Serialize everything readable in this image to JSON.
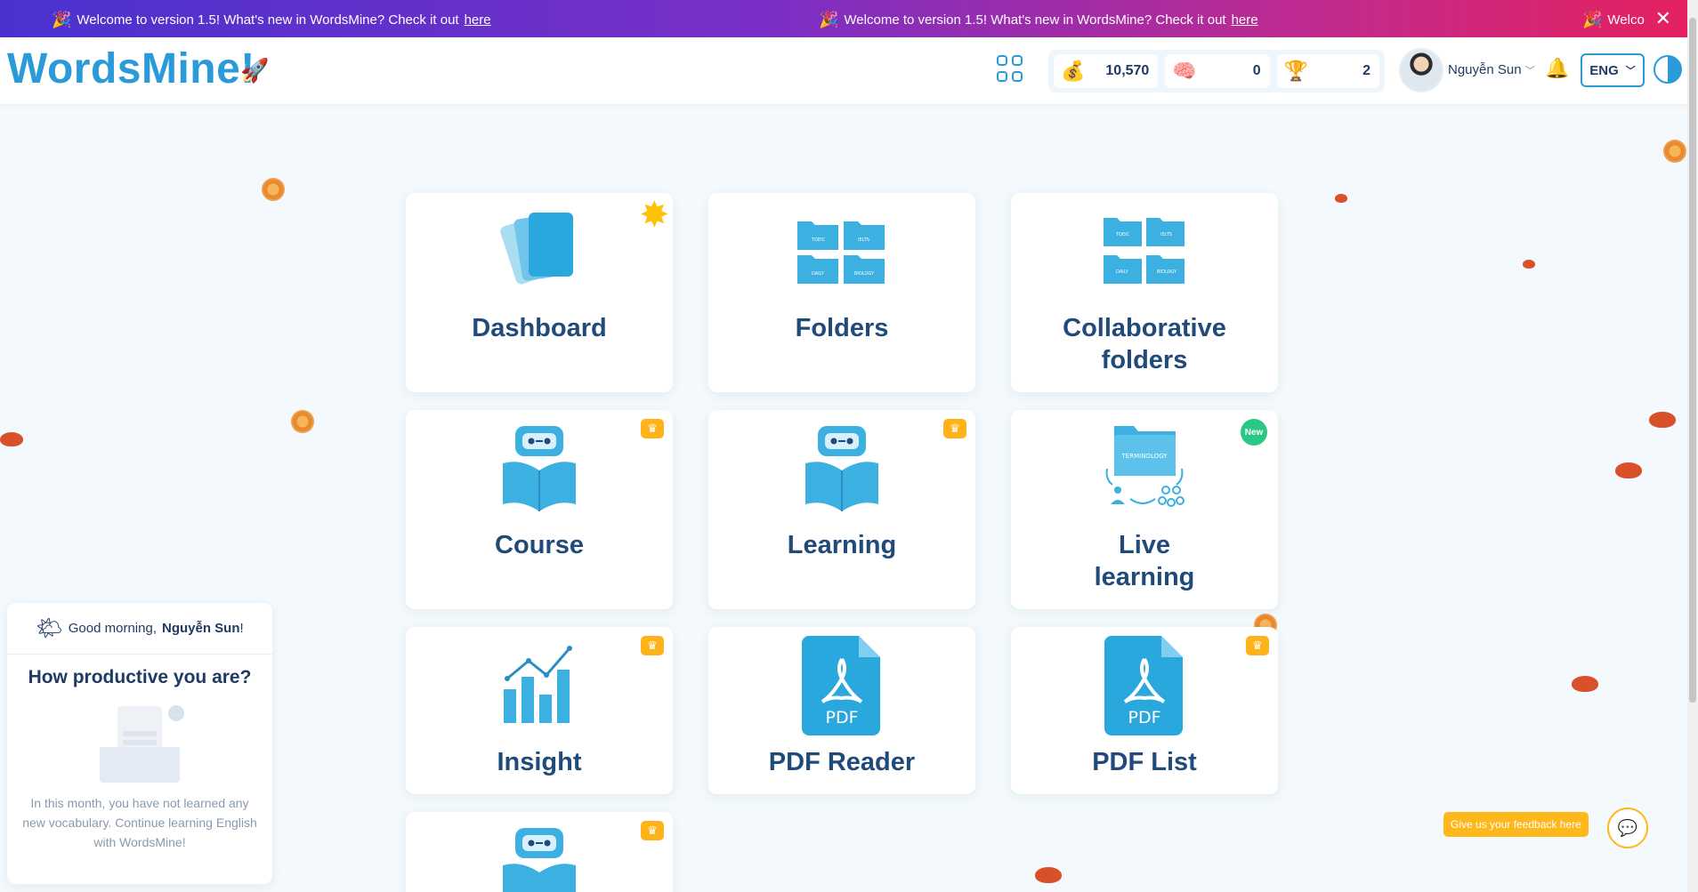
{
  "banner": {
    "message": "Welcome to version 1.5! What's new in WordsMine? Check it out",
    "link": "here",
    "message_partial": "Welco",
    "party_icon": "party-popper-icon",
    "close_icon": "close-icon"
  },
  "header": {
    "logo": "WordsMine!",
    "coins": "10,570",
    "brain": "0",
    "trophy": "2",
    "username": "Nguyễn Sun",
    "language": "ENG"
  },
  "cards": {
    "dashboard": "Dashboard",
    "folders": "Folders",
    "collab_line1": "Collaborative",
    "collab_line2": "folders",
    "course": "Course",
    "learning": "Learning",
    "live_line1": "Live",
    "live_line2": "learning",
    "insight": "Insight",
    "pdf_reader": "PDF Reader",
    "pdf_list": "PDF List",
    "new_badge": "New",
    "pdf_label": "PDF",
    "folder_labels": [
      "TOEIC",
      "IELTS",
      "DAILY",
      "BIOLOGY"
    ],
    "terminology": "TERMINOLOGY"
  },
  "greeting": {
    "prefix": "Good morning,",
    "name": "Nguyễn Sun",
    "suffix": "!",
    "question": "How productive you are?",
    "message": "In this month, you have not learned any new vocabulary. Continue learning English with WordsMine!"
  },
  "feedback": {
    "label": "Give us your feedback here"
  },
  "colors": {
    "brand": "#2a9bd8",
    "title": "#1f4a7a",
    "accent": "#ffb31a",
    "new": "#2bc784"
  }
}
